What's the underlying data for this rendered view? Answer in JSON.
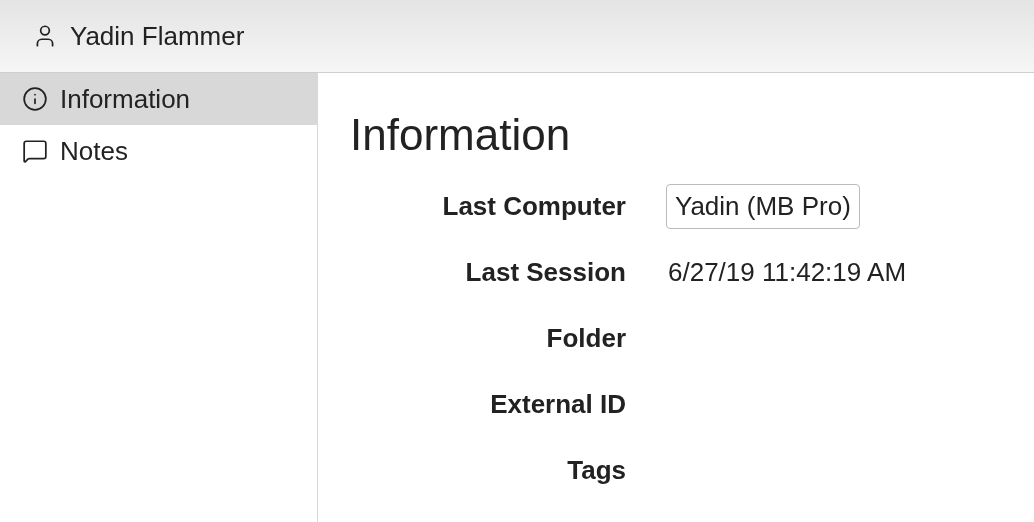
{
  "header": {
    "user_name": "Yadin Flammer"
  },
  "sidebar": {
    "items": [
      {
        "label": "Information",
        "selected": true
      },
      {
        "label": "Notes",
        "selected": false
      }
    ]
  },
  "content": {
    "title": "Information",
    "fields": [
      {
        "label": "Last Computer",
        "kind": "button",
        "value": "Yadin (MB Pro)"
      },
      {
        "label": "Last Session",
        "kind": "text",
        "value": "6/27/19 11:42:19 AM"
      },
      {
        "label": "Folder"
      },
      {
        "label": "External ID"
      },
      {
        "label": "Tags"
      }
    ]
  }
}
